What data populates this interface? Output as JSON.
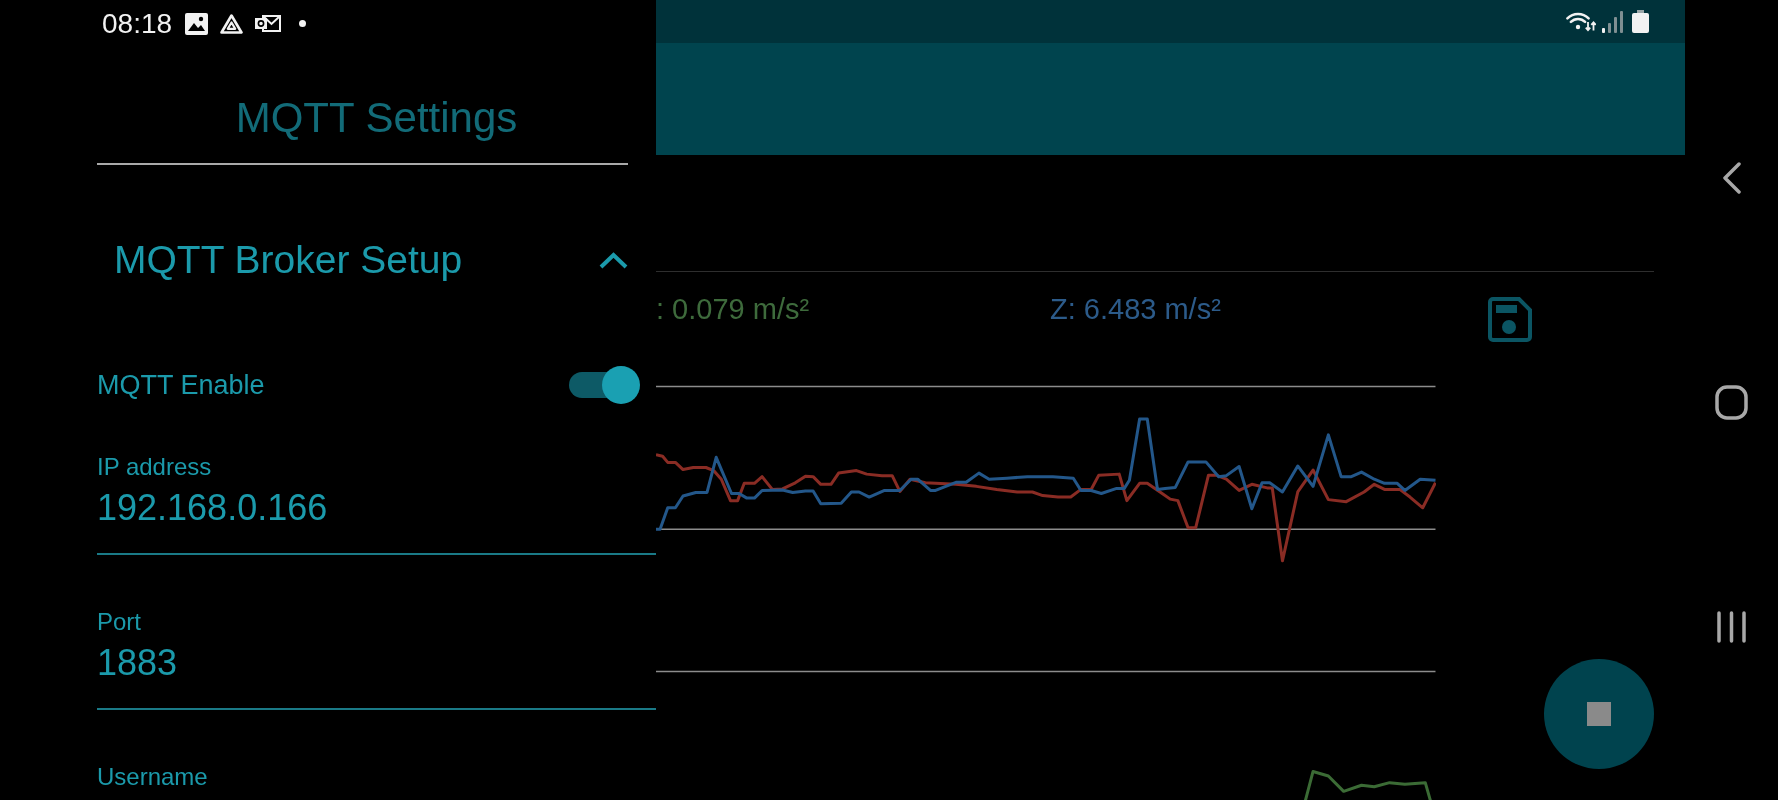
{
  "status_bar": {
    "time": "08:18"
  },
  "drawer": {
    "title": "MQTT Settings",
    "section": {
      "title": "MQTT Broker Setup",
      "expanded": true
    },
    "items": [
      {
        "kind": "switch",
        "label": "MQTT Enable",
        "on": true
      },
      {
        "kind": "field",
        "label": "IP address",
        "value": "192.168.0.166"
      },
      {
        "kind": "field",
        "label": "Port",
        "value": "1883"
      },
      {
        "kind": "field",
        "label": "Username"
      }
    ]
  },
  "main": {
    "readings": [
      {
        "text": ": 0.079 m/s²",
        "color": "#3e6b3c"
      },
      {
        "text": "Z: 6.483 m/s²",
        "color": "#2c5b8a"
      }
    ]
  }
}
